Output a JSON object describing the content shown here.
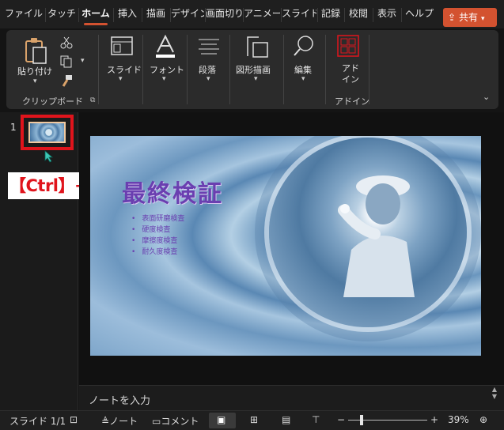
{
  "tabs": [
    "ファイル",
    "タッチ",
    "ホーム",
    "挿入",
    "描画",
    "デザイン",
    "画面切り替え",
    "アニメーション",
    "スライド",
    "記録",
    "校閲",
    "表示",
    "ヘルプ"
  ],
  "active_tab": "ホーム",
  "share_label": "共有",
  "ribbon": {
    "paste_label": "貼り付け",
    "clipboard_group": "クリップボード",
    "slides_label": "スライド",
    "font_label": "フォント",
    "paragraph_label": "段落",
    "drawing_label": "図形描画",
    "editing_label": "編集",
    "addin_label": "アド\nイン",
    "addin_group": "アドイン"
  },
  "thumbnail": {
    "number": "1"
  },
  "callout": "【Ctrl】+【C】でコピー",
  "slide": {
    "title": "最終検証",
    "bullets": [
      "表面研磨検査",
      "硬度検査",
      "摩擦度検査",
      "耐久度検査"
    ]
  },
  "notes_placeholder": "ノートを入力",
  "status": {
    "slide_info": "スライド 1/1",
    "notes_label": "ノート",
    "comments_label": "コメント",
    "zoom": "39%"
  },
  "colors": {
    "accent": "#d35230",
    "highlight": "#e0141c",
    "title_purple": "#6a3fb0"
  }
}
